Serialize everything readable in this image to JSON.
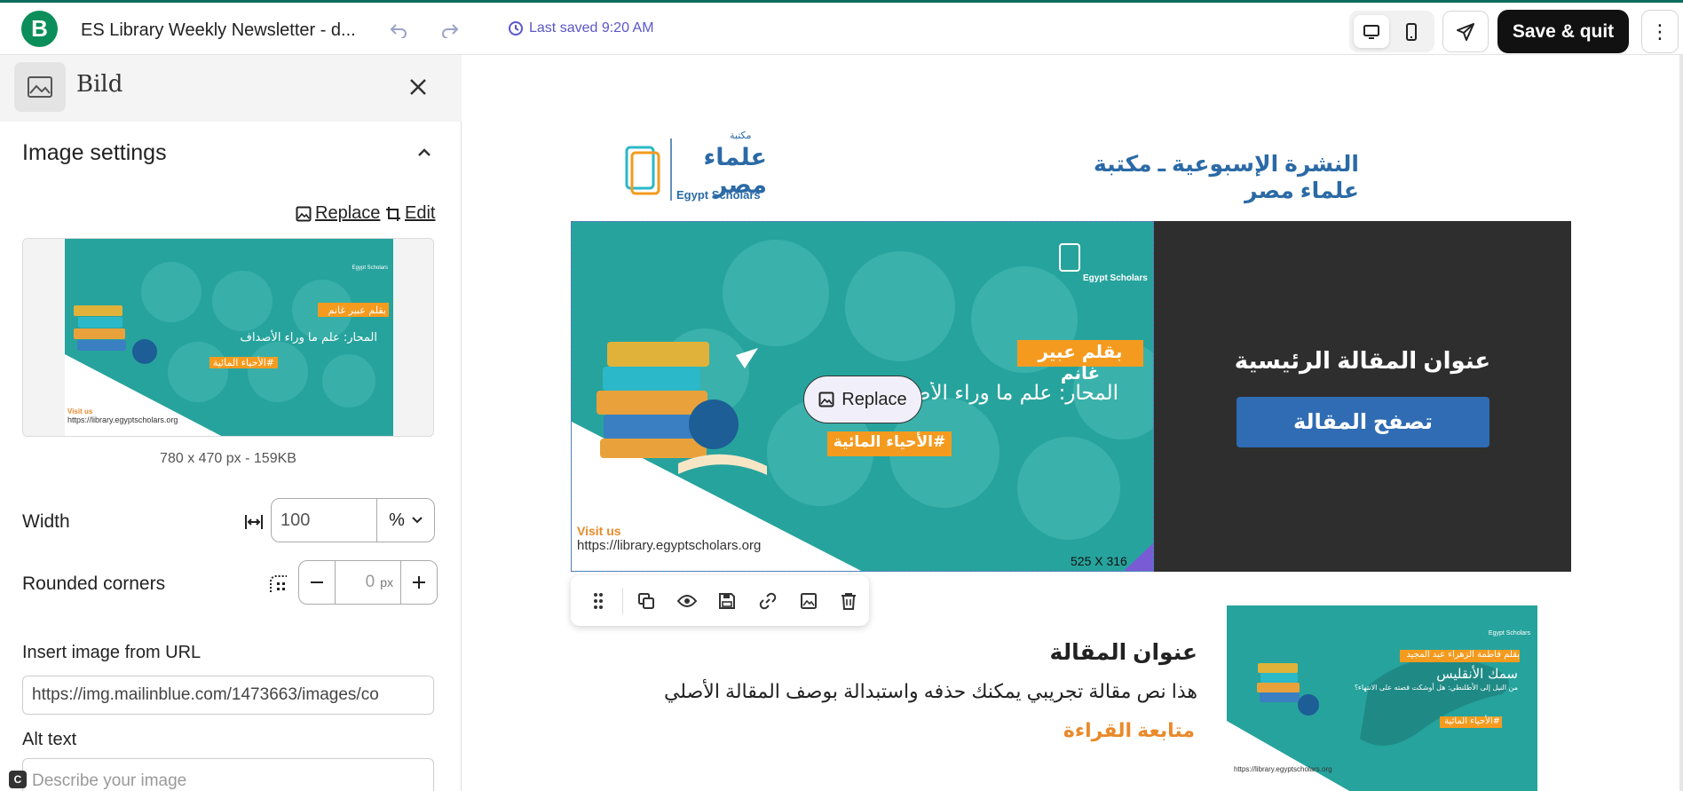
{
  "topbar": {
    "logo_letter": "B",
    "doc_title": "ES Library Weekly Newsletter - d...",
    "undo_icon": "undo-icon",
    "redo_icon": "redo-icon",
    "last_saved": "Last saved 9:20 AM",
    "save_quit": "Save & quit",
    "more": "⋮"
  },
  "panel": {
    "title": "Bild",
    "section_title": "Image settings",
    "replace_label": "Replace",
    "edit_label": "Edit",
    "image_meta": "780 x 470 px - 159KB",
    "width_label": "Width",
    "width_value": "100",
    "width_unit": "%",
    "rounded_label": "Rounded corners",
    "rounded_value": "0",
    "rounded_unit": "px",
    "url_label": "Insert image from URL",
    "url_value": "https://img.mailinblue.com/1473663/images/co",
    "alt_label": "Alt text",
    "alt_placeholder": "Describe your image",
    "c_badge": "C"
  },
  "thumb": {
    "author_tag": "بقلم عبير غانم",
    "headline": "المحار: علم ما وراء الأصداف",
    "hashtag": "#الأحياء المائية",
    "visit_label": "Visit us",
    "visit_url": "https://library.egyptscholars.org",
    "logo_text": "Egypt Scholars"
  },
  "canvas": {
    "header_title": "النشرة الإسبوعية  ـ مكتبة علماء مصر",
    "header_logo_ar": "علماء مصر",
    "header_logo_top": "مكتبة",
    "header_logo_en": "Egypt Scholars",
    "hero": {
      "author_tag": "بقلم عبير غانم",
      "headline": "المحار: علم ما وراء الأصداف",
      "hashtag": "#الأحياء المائية",
      "visit_label": "Visit us",
      "visit_url": "https://library.egyptscholars.org",
      "logo_text": "Egypt Scholars",
      "replace_label": "Replace",
      "dims": "525 X 316",
      "side_title": "عنوان المقالة الرئيسية",
      "side_button": "تصفح المقالة"
    },
    "article": {
      "title": "عنوان المقالة",
      "body": "هذا نص مقالة تجريبي يمكنك حذفه واستبدالة بوصف المقالة الأصلي",
      "more": "متابعة القراءة",
      "img_author": "بقلم فاطمة الزهراء عبد المجيد",
      "img_headline": "سمك الأنقليس",
      "img_sub": "من النيل إلى الأطلنطي: هل أوشكت قصته على الانتهاء؟",
      "img_hashtag": "#الأحياء المائية",
      "img_url": "https://library.egyptscholars.org",
      "img_logo_text": "Egypt Scholars"
    }
  },
  "colors": {
    "accent": "#5a56c8",
    "brand_green": "#0b8e5a",
    "teal": "#27a39d",
    "orange": "#f49b1f",
    "blue_button": "#2f6cb3",
    "dark_side": "#2e2e2e"
  }
}
